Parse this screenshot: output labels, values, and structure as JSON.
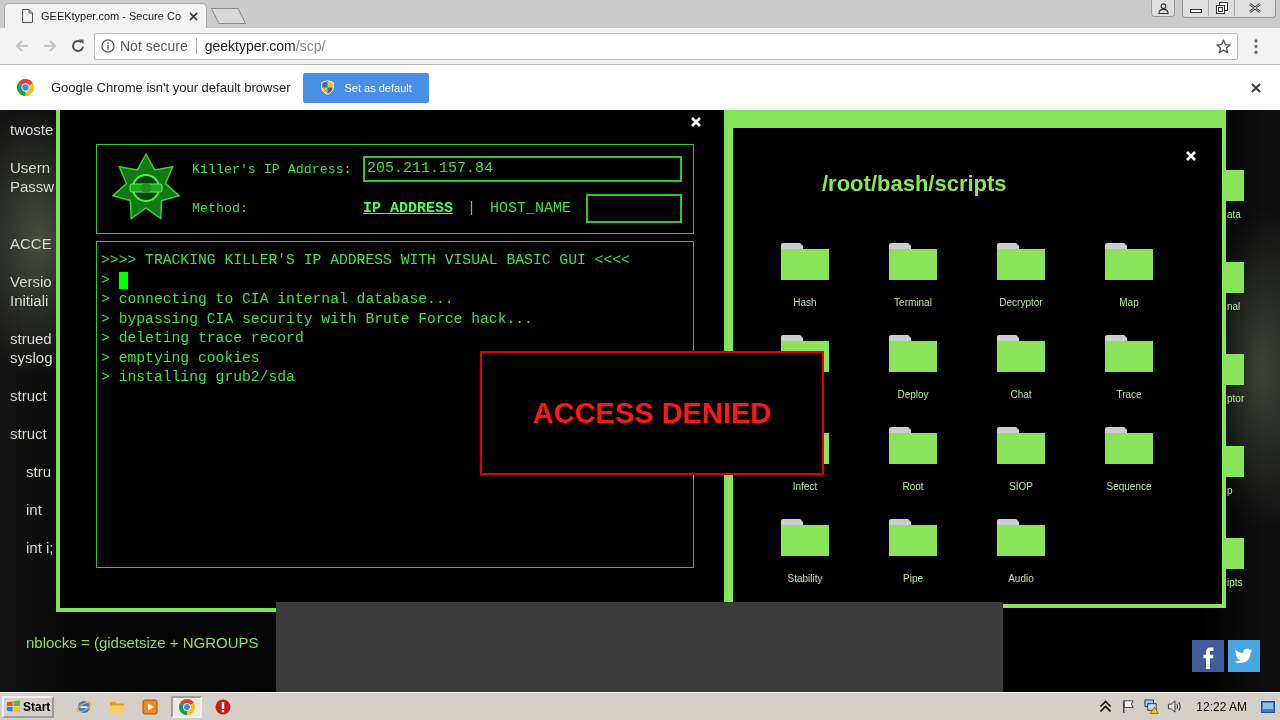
{
  "browser": {
    "tabs": [
      {
        "title": "GEEKtyper.com - Secure Co",
        "selected": true
      }
    ],
    "address": {
      "security": "Not secure",
      "host": "geektyper.com",
      "path": "/scp/"
    }
  },
  "infobar": {
    "message": "Google Chrome isn't your default browser",
    "button": "Set as default"
  },
  "background_code": {
    "sections": [
      {
        "paragraphs": [
          {
            "lines": [
              "twoste"
            ]
          },
          {
            "lines": [
              "Usern",
              "Passw"
            ]
          }
        ]
      },
      {
        "paragraphs": [
          {
            "lines": [
              "ACCE"
            ]
          },
          {
            "lines": [
              "Versio",
              "Initiali"
            ]
          },
          {
            "lines": [
              "strued",
              "syslog"
            ]
          },
          {
            "lines": [
              "struct"
            ]
          },
          {
            "lines": [
              "struct"
            ],
            "children": [
              {
                "lines": [
                  "stru"
                ]
              },
              {
                "lines": [
                  "int"
                ]
              },
              {
                "lines": [
                  "int i;"
                ]
              }
            ]
          }
        ]
      }
    ],
    "footer": "nblocks = (gidsetsize + NGROUPS"
  },
  "desktop_labels": [
    "ata",
    "nal",
    "ptor",
    "p",
    "ipts"
  ],
  "tracker_window": {
    "ip_label": "Killer's IP Address:",
    "ip_value": "205.211.157.84",
    "method_label": "Method:",
    "methods": [
      {
        "label": "IP_ADDRESS",
        "selected": true
      },
      {
        "label": "HOST_NAME",
        "selected": false
      }
    ],
    "separator": "|",
    "terminal": [
      {
        "text": ">>>> TRACKING KILLER'S IP ADDRESS WITH VISUAL BASIC GUI <<<<",
        "cursor": false
      },
      {
        "text": ">",
        "cursor": true
      },
      {
        "text": "> connecting to CIA internal database...",
        "cursor": false
      },
      {
        "text": "> bypassing CIA security with Brute Force hack...",
        "cursor": false
      },
      {
        "text": "> deleting trace record",
        "cursor": false
      },
      {
        "text": "> emptying cookies",
        "cursor": false
      },
      {
        "text": "> installing grub2/sda",
        "cursor": false
      }
    ]
  },
  "scripts_window": {
    "title": "/root/bash/scripts",
    "folders": [
      {
        "kind": "folder",
        "label": "Hash"
      },
      {
        "kind": "folder",
        "label": "Terminal"
      },
      {
        "kind": "folder",
        "label": "Decryptor"
      },
      {
        "kind": "folder",
        "label": "Map"
      },
      {
        "kind": "folder"
      },
      {
        "kind": "folder",
        "label": "Deploy"
      },
      {
        "kind": "folder",
        "label": "Chat"
      },
      {
        "kind": "folder",
        "label": "Trace"
      },
      {
        "kind": "folder",
        "label": "Infect"
      },
      {
        "kind": "folder",
        "label": "Root"
      },
      {
        "kind": "folder",
        "label": "SIOP"
      },
      {
        "kind": "folder",
        "label": "Sequence"
      },
      {
        "kind": "folder",
        "label": "Stability"
      },
      {
        "kind": "folder",
        "label": "Pipe"
      },
      {
        "kind": "folder",
        "label": "Audio"
      }
    ]
  },
  "dialog": {
    "message": "ACCESS DENIED"
  },
  "taskbar": {
    "start": "Start",
    "apps": [
      {
        "kind": "globe",
        "selected": false
      },
      {
        "kind": "folder",
        "selected": false
      },
      {
        "kind": "media",
        "selected": false
      },
      {
        "kind": "logo",
        "selected": true
      },
      {
        "kind": "alert",
        "selected": false
      }
    ],
    "clock": "12:22 AM"
  }
}
